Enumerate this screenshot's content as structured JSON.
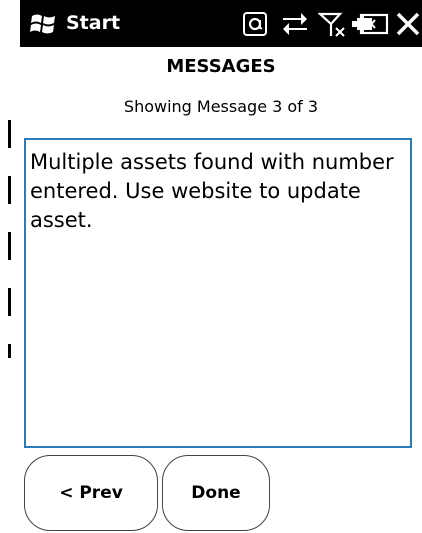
{
  "status_bar": {
    "start_label": "Start",
    "icons": [
      "windows-logo-icon",
      "at-icon",
      "sync-icon",
      "signal-icon",
      "sound-icon",
      "battery-icon",
      "close-icon"
    ]
  },
  "page": {
    "title": "MESSAGES",
    "counter": "Showing Message 3 of 3"
  },
  "message": {
    "text": "Multiple assets found with number entered. Use website to update asset."
  },
  "buttons": {
    "prev_label": "< Prev",
    "done_label": "Done"
  },
  "colors": {
    "status_bar_bg": "#000000",
    "message_border": "#2b7bb9",
    "background": "#ffffff"
  }
}
